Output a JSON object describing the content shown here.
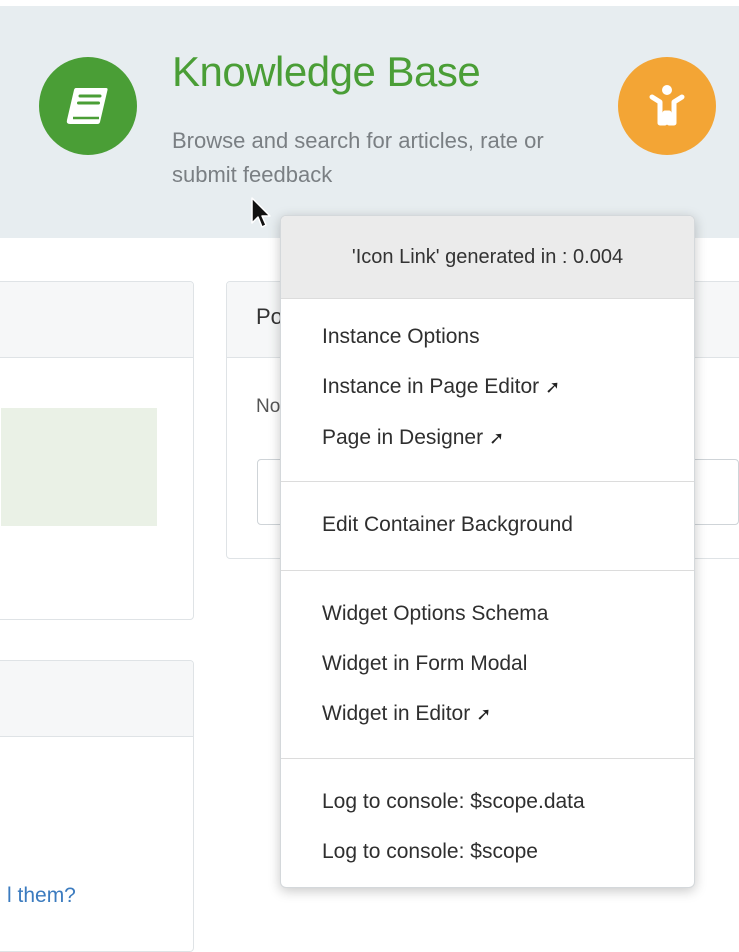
{
  "hero": {
    "title": "Knowledge Base",
    "subtitle": "Browse and search for articles, rate or submit feedback",
    "left_icon": "book-icon",
    "right_icon": "accessibility-person-icon",
    "colors": {
      "green": "#4a9e36",
      "orange": "#f3a535",
      "band": "#e7edf0"
    }
  },
  "panels": {
    "right_panel_title_partial": "Po",
    "right_panel_text_partial": "No",
    "bottom_link_partial": "l them?"
  },
  "context_menu": {
    "header": "'Icon Link' generated in : 0.004",
    "groups": [
      {
        "items": [
          {
            "label": "Instance Options",
            "external": false
          },
          {
            "label": "Instance in Page Editor",
            "external": true
          },
          {
            "label": "Page in Designer",
            "external": true
          }
        ]
      },
      {
        "items": [
          {
            "label": "Edit Container Background",
            "external": false
          }
        ]
      },
      {
        "items": [
          {
            "label": "Widget Options Schema",
            "external": false
          },
          {
            "label": "Widget in Form Modal",
            "external": false
          },
          {
            "label": "Widget in Editor",
            "external": true
          }
        ]
      },
      {
        "items": [
          {
            "label": "Log to console: $scope.data",
            "external": false
          },
          {
            "label": "Log to console: $scope",
            "external": false
          }
        ]
      }
    ]
  }
}
